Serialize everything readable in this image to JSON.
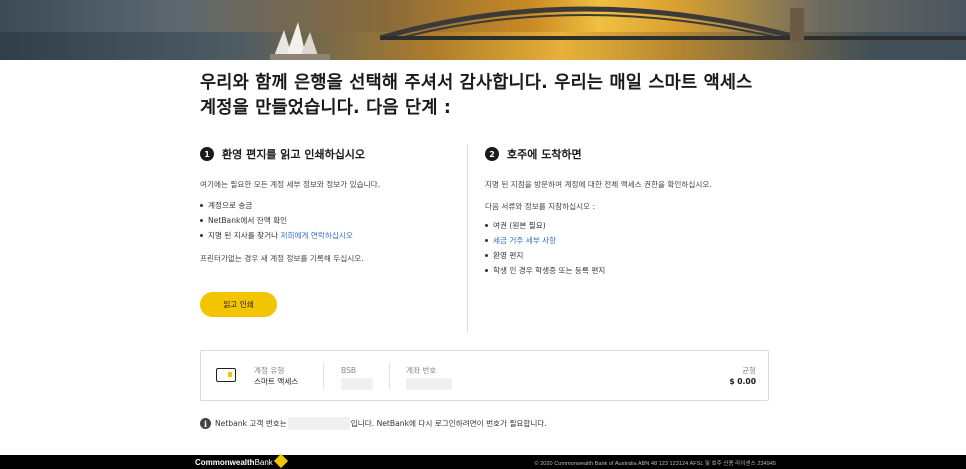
{
  "heading": "우리와 함께 은행을 선택해 주셔서 감사합니다. 우리는 매일 스마트 액세스 계정을 만들었습니다. 다음 단계 :",
  "step1": {
    "number": "1",
    "title": "환영 편지를 읽고 인쇄하십시오",
    "intro": "여기에는 필요한 모든 계정 세부 정보와 정보가 있습니다.",
    "items": [
      {
        "text": "계정으로 송금"
      },
      {
        "text": "NetBank에서 잔액 확인"
      },
      {
        "prefix": "지명 된 지사를 찾거나 ",
        "link": "저희에게 연락하십시오"
      }
    ],
    "note": "프린터가없는 경우 새 계정 정보를 기록해 두십시오.",
    "button_label": "읽고 인쇄"
  },
  "step2": {
    "number": "2",
    "title": "호주에 도착하면",
    "intro": "지명 된 지점을 방문하여 계정에 대한 전체 액세스 권한을 확인하십시오.",
    "docs_intro": "다음 서류와 정보를 지참하십시오 :",
    "items": [
      {
        "text": "여권 (원본 필요)",
        "link": false
      },
      {
        "text": "세금 거주 세부 사항",
        "link": true
      },
      {
        "text": "환영 편지",
        "link": false
      },
      {
        "text": "학생 인 경우 학생증 또는 등록 편지",
        "link": false
      }
    ]
  },
  "account": {
    "type_label": "계정 유형",
    "type_value": "스마트 액세스",
    "bsb_label": "BSB",
    "number_label": "계좌 번호",
    "balance_label": "균형",
    "balance_value": "$ 0.00"
  },
  "info": {
    "before": "Netbank 고객 번호는",
    "after": "입니다. NetBank에 다시 로그인하려면이 번호가 필요합니다."
  },
  "footer": {
    "logo_bold": "Commonwealth",
    "logo_light": "Bank",
    "copyright": "© 2020 Commonwealth Bank of Australia ABN 48 123 123124 AFSL 및 호주 신용 라이센스 234945"
  },
  "colors": {
    "accent_yellow": "#f2c500",
    "link_blue": "#3a6ec4",
    "footer_bg": "#000000"
  }
}
